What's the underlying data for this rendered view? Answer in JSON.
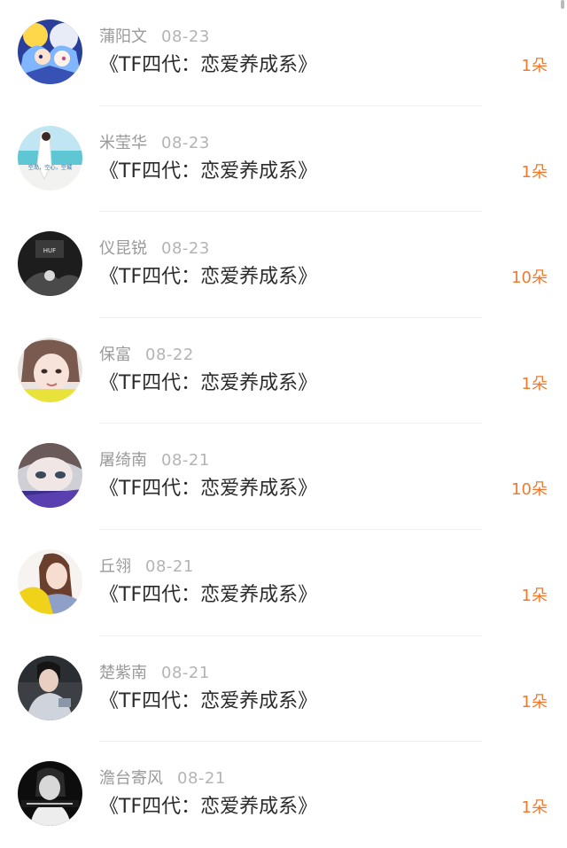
{
  "colors": {
    "name": "#9a9a9a",
    "date": "#b4b4b4",
    "title": "#2b2b2b",
    "amount": "#f07a2c",
    "divider": "#f0f0f0"
  },
  "items": [
    {
      "name": "蒲阳文",
      "date": "08-23",
      "title": "《TF四代：恋爱养成系》",
      "amount": "1朵",
      "avatar_icon": "anime-avatar-icon"
    },
    {
      "name": "米莹华",
      "date": "08-23",
      "title": "《TF四代：恋爱养成系》",
      "amount": "1朵",
      "avatar_icon": "beach-avatar-icon",
      "avatar_text": "空岛，空心，空城"
    },
    {
      "name": "仪昆锐",
      "date": "08-23",
      "title": "《TF四代：恋爱养成系》",
      "amount": "10朵",
      "avatar_icon": "dark-avatar-icon",
      "avatar_text": "HUF"
    },
    {
      "name": "保富",
      "date": "08-22",
      "title": "《TF四代：恋爱养成系》",
      "amount": "1朵",
      "avatar_icon": "girl-face-avatar-icon"
    },
    {
      "name": "屠绮南",
      "date": "08-21",
      "title": "《TF四代：恋爱养成系》",
      "amount": "10朵",
      "avatar_icon": "eyes-avatar-icon"
    },
    {
      "name": "丘翎",
      "date": "08-21",
      "title": "《TF四代：恋爱养成系》",
      "amount": "1朵",
      "avatar_icon": "yellow-jacket-avatar-icon"
    },
    {
      "name": "楚紫南",
      "date": "08-21",
      "title": "《TF四代：恋爱养成系》",
      "amount": "1朵",
      "avatar_icon": "boy-avatar-icon"
    },
    {
      "name": "澹台寄风",
      "date": "08-21",
      "title": "《TF四代：恋爱养成系》",
      "amount": "1朵",
      "avatar_icon": "black-white-avatar-icon"
    }
  ]
}
